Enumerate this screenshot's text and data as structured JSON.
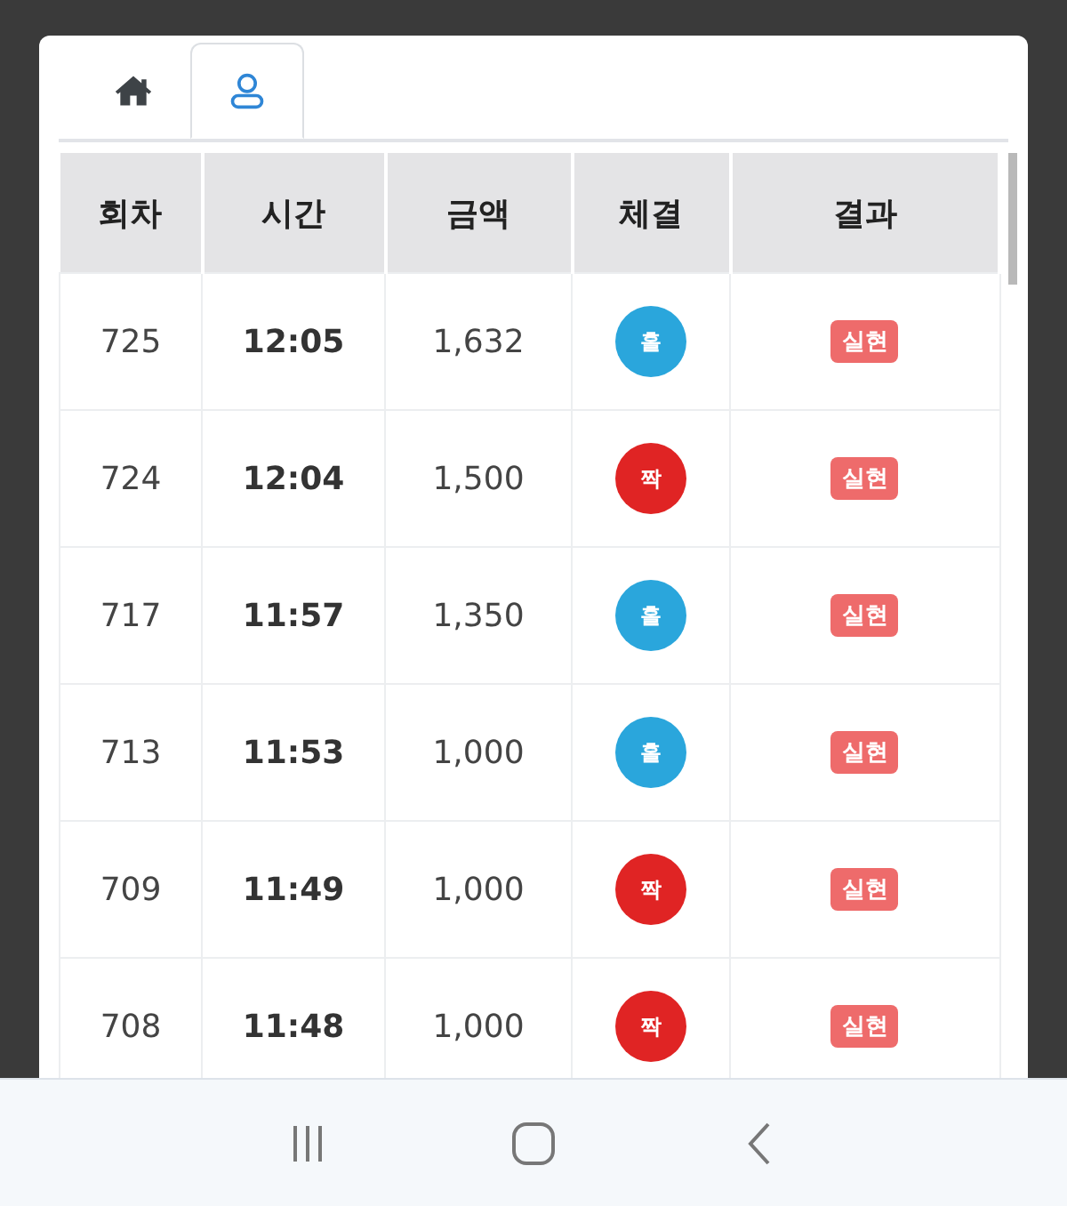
{
  "tabs": [
    {
      "kind": "home",
      "selected": false
    },
    {
      "kind": "user",
      "selected": true
    }
  ],
  "table": {
    "columns": [
      "회차",
      "시간",
      "금액",
      "체결",
      "결과"
    ],
    "rows": [
      {
        "round": "725",
        "time": "12:05",
        "amount": "1,632",
        "fill": {
          "label": "홀",
          "color": "#2aa6dc"
        },
        "result": "실현"
      },
      {
        "round": "724",
        "time": "12:04",
        "amount": "1,500",
        "fill": {
          "label": "짝",
          "color": "#e02424"
        },
        "result": "실현"
      },
      {
        "round": "717",
        "time": "11:57",
        "amount": "1,350",
        "fill": {
          "label": "홀",
          "color": "#2aa6dc"
        },
        "result": "실현"
      },
      {
        "round": "713",
        "time": "11:53",
        "amount": "1,000",
        "fill": {
          "label": "홀",
          "color": "#2aa6dc"
        },
        "result": "실현"
      },
      {
        "round": "709",
        "time": "11:49",
        "amount": "1,000",
        "fill": {
          "label": "짝",
          "color": "#e02424"
        },
        "result": "실현"
      },
      {
        "round": "708",
        "time": "11:48",
        "amount": "1,000",
        "fill": {
          "label": "짝",
          "color": "#e02424"
        },
        "result": "실현"
      }
    ]
  }
}
